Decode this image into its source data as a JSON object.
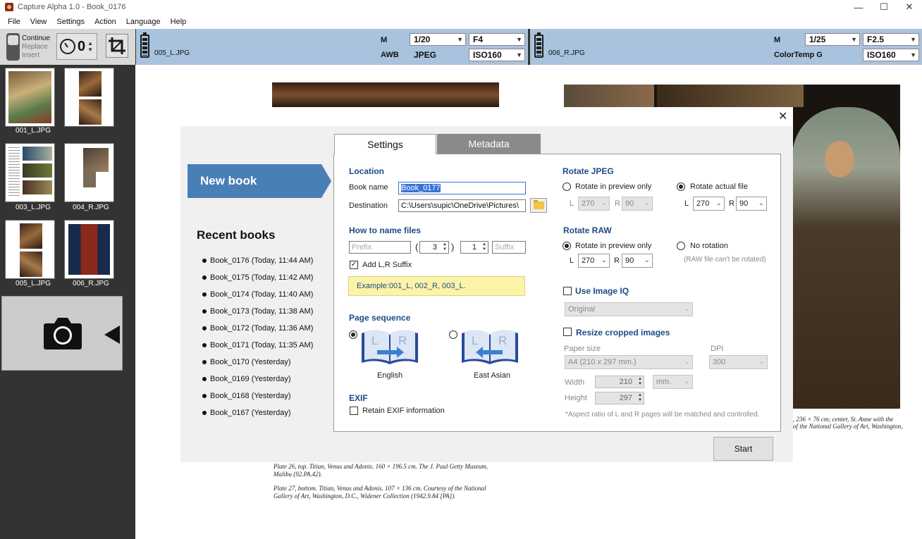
{
  "window": {
    "title": "Capture Alpha 1.0 - Book_0176",
    "minimize": "—",
    "maximize": "☐",
    "close": "✕"
  },
  "menu": [
    "File",
    "View",
    "Settings",
    "Action",
    "Language",
    "Help"
  ],
  "toolbar": {
    "mode": {
      "continue": "Continue",
      "replace": "Replace",
      "insert": "Insert"
    },
    "timer_value": "0"
  },
  "camera_left": {
    "file": "005_L.JPG",
    "mode": "M",
    "wb": "AWB",
    "shutter": "1/20",
    "aperture": "F4",
    "format": "JPEG",
    "iso": "ISO160"
  },
  "camera_right": {
    "file": "006_R.JPG",
    "mode": "M",
    "wb": "ColorTemp G",
    "shutter": "1/25",
    "aperture": "F2.5",
    "iso": "ISO160"
  },
  "thumbnails": [
    "001_L.JPG",
    "003_L.JPG",
    "004_R.JPG",
    "005_L.JPG",
    "006_R.JPG"
  ],
  "document": {
    "caption_right_1": ", 236 × 76 cm; center, St. Anne with the",
    "caption_right_2": "of the National Gallery of Art, Washington,",
    "caption_left_1a": "Plate 26, top.  Titian, Venus and Adonis. 160 × 196.5 cm. The J. Paul Getty Museum,",
    "caption_left_1b": "Malibu (92.PA.42).",
    "caption_left_2a": "Plate 27, bottom.  Titian, Venus and Adonis. 107 × 136 cm. Courtesy of the National",
    "caption_left_2b": "Gallery of Art, Washington, D.C., Widener Collection (1942.9.84 [PA])."
  },
  "dialog": {
    "close": "✕",
    "new_book": "New book",
    "recent_title": "Recent books",
    "recent": [
      "Book_0176 (Today, 11:44 AM)",
      "Book_0175 (Today, 11:42 AM)",
      "Book_0174 (Today, 11:40 AM)",
      "Book_0173 (Today, 11:38 AM)",
      "Book_0172 (Today, 11:36 AM)",
      "Book_0171 (Today, 11:35 AM)",
      "Book_0170 (Yesterday)",
      "Book_0169 (Yesterday)",
      "Book_0168 (Yesterday)",
      "Book_0167 (Yesterday)"
    ],
    "tabs": {
      "settings": "Settings",
      "metadata": "Metadata"
    },
    "location": {
      "title": "Location",
      "book_name_label": "Book name",
      "book_name": "Book_0177",
      "destination_label": "Destination",
      "destination": "C:\\Users\\supic\\OneDrive\\Pictures\\"
    },
    "naming": {
      "title": "How to name files",
      "prefix_placeholder": "Prefix",
      "paren_open": "(",
      "digits": "3",
      "paren_close": ")",
      "start": "1",
      "suffix_placeholder": "Suffix",
      "add_lr": "Add L,R Suffix",
      "example": "Example:001_L, 002_R, 003_L."
    },
    "page_sequence": {
      "title": "Page sequence",
      "english": "English",
      "east_asian": "East Asian"
    },
    "exif": {
      "title": "EXIF",
      "retain": "Retain EXIF information"
    },
    "rotate_jpeg": {
      "title": "Rotate JPEG",
      "preview_only": "Rotate in preview only",
      "actual": "Rotate actual file",
      "l": "L",
      "r": "R",
      "l_val_dis": "270",
      "r_val_dis": "90",
      "l_val": "270",
      "r_val": "90"
    },
    "rotate_raw": {
      "title": "Rotate RAW",
      "preview_only": "Rotate in preview only",
      "no_rotation": "No rotation",
      "note": "(RAW file can't be rotated)",
      "l": "L",
      "r": "R",
      "l_val": "270",
      "r_val": "90"
    },
    "image_iq": {
      "title": "Use Image IQ",
      "value": "Original"
    },
    "resize": {
      "title": "Resize cropped images",
      "paper_label": "Paper size",
      "paper": "A4 (210 x 297 mm.)",
      "dpi_label": "DPI",
      "dpi": "300",
      "width_label": "Width",
      "width": "210",
      "height_label": "Height",
      "height": "297",
      "unit": "mm.",
      "note": "*Aspect ratio of L and R pages will be matched and controlled."
    },
    "start": "Start"
  },
  "colors": {
    "accent": "#4a7fb6",
    "section_title": "#1e4b84",
    "camera_panel": "#a9c2de",
    "sidebar": "#333333"
  }
}
